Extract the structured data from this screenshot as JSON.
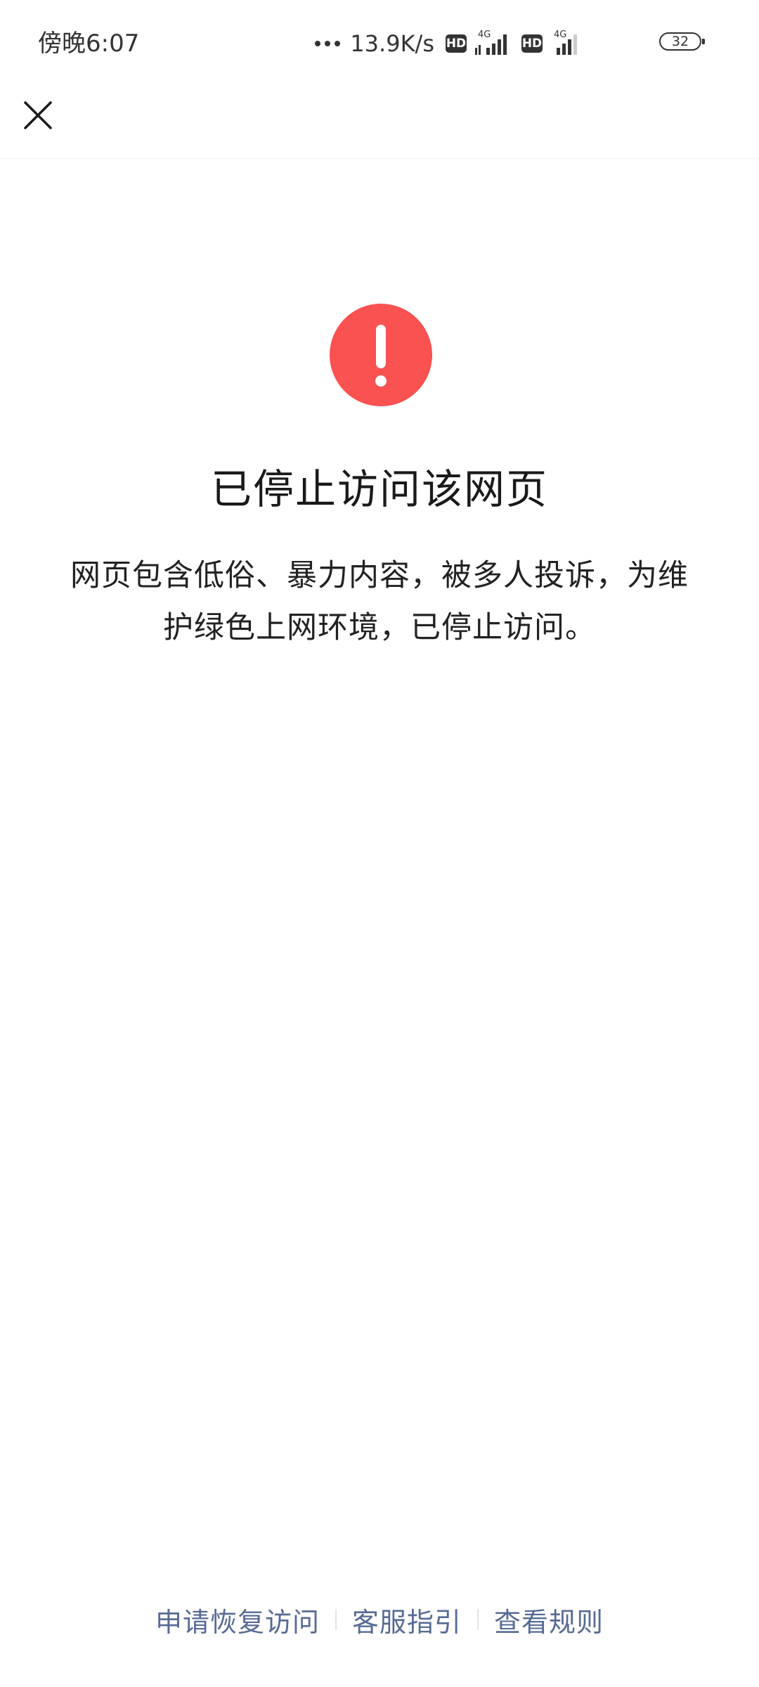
{
  "status_bar": {
    "time": "傍晚6:07",
    "net_speed": "13.9K/s",
    "hd_label": "HD",
    "network_type_1": "4G",
    "network_type_2": "4G",
    "battery_level": "32",
    "icons": [
      "more-dots-icon",
      "hd-icon",
      "signal-icon",
      "battery-icon"
    ]
  },
  "nav": {
    "close_icon": "close-icon"
  },
  "main": {
    "icon": "warning-icon",
    "icon_color": "#fa5151",
    "title": "已停止访问该网页",
    "description": "网页包含低俗、暴力内容，被多人投诉，为维护绿色上网环境，已停止访问。"
  },
  "footer": {
    "link_color": "#576b95",
    "links": [
      {
        "label": "申请恢复访问"
      },
      {
        "label": "客服指引"
      },
      {
        "label": "查看规则"
      }
    ]
  }
}
